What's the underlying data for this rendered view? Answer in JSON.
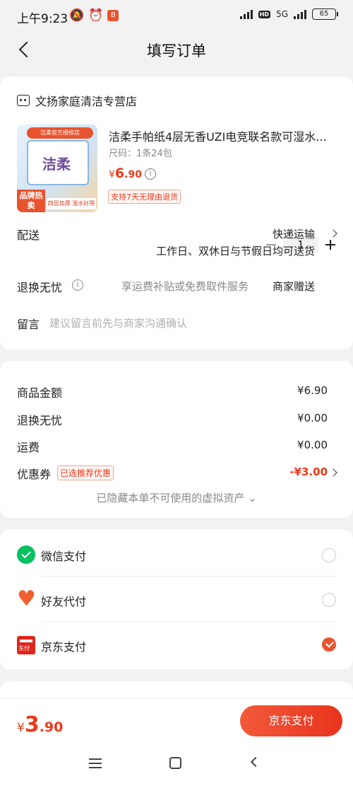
{
  "status_bar": {
    "time": "上午9:23",
    "network": "5G",
    "battery": "65"
  },
  "header": {
    "title": "填写订单"
  },
  "shop": {
    "name": "文扬家庭清洁专营店"
  },
  "product": {
    "image_banner": "洁柔官方授权店",
    "image_tag": "品牌热卖",
    "image_slogan": "四层加厚 湿水好用",
    "name": "洁柔手帕纸4层无香UZI电竞联名款可湿水...",
    "spec": "尺码：1条24包",
    "price_currency": "¥",
    "price_int": "6",
    "price_dec": ".90",
    "quantity": "1",
    "return_policy": "支持7天无理由退货"
  },
  "delivery": {
    "label": "配送",
    "method": "快递运输",
    "time": "工作日、双休日与节假日均可送货"
  },
  "return_service": {
    "label": "退换无忧",
    "desc": "享运费补贴或免费取件服务",
    "gift": "商家赠送"
  },
  "message": {
    "label": "留言",
    "placeholder": "建议留言前先与商家沟通确认"
  },
  "price_summary": {
    "goods_label": "商品金额",
    "goods_value": "¥6.90",
    "return_label": "退换无忧",
    "return_value": "¥0.00",
    "shipping_label": "运费",
    "shipping_value": "¥0.00",
    "coupon_label": "优惠券",
    "coupon_badge": "已选推荐优惠",
    "coupon_value": "-¥3.00",
    "hidden_assets": "已隐藏本单不可使用的虚拟资产 ⌄"
  },
  "payment": {
    "methods": [
      {
        "label": "微信支付",
        "selected": false
      },
      {
        "label": "好友代付",
        "selected": false
      },
      {
        "label": "京东支付",
        "selected": true
      }
    ]
  },
  "bottom": {
    "total_currency": "¥",
    "total_int": "3",
    "total_dec": ".90",
    "pay_button": "京东支付"
  },
  "colors": {
    "accent": "#e8542f",
    "price": "#e83a1c",
    "wechat": "#07c160"
  }
}
